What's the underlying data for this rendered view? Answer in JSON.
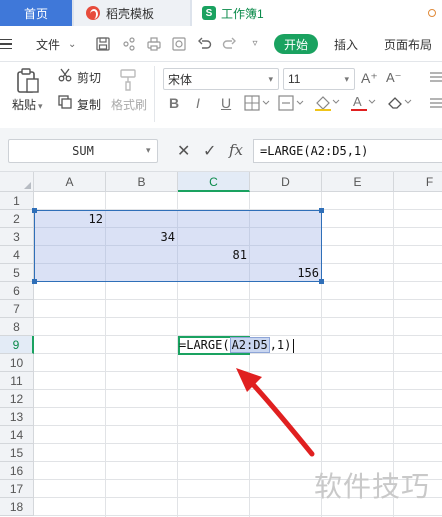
{
  "tabs": [
    {
      "label": "首页"
    },
    {
      "label": "稻壳模板"
    },
    {
      "label": "工作簿1"
    }
  ],
  "menu": {
    "file": "文件",
    "start": "开始",
    "insert": "插入",
    "page_layout": "页面布局"
  },
  "ribbon": {
    "paste": "粘贴",
    "cut": "剪切",
    "copy": "复制",
    "format_painter": "格式刷",
    "font_name": "宋体",
    "font_size": "11",
    "bold": "B",
    "italic": "I",
    "underline": "U",
    "font_grow": "A⁺",
    "font_shrink": "A⁻"
  },
  "formula_bar": {
    "name_box": "SUM",
    "formula": "=LARGE(A2:D5,1)",
    "cancel": "✕",
    "confirm": "✓",
    "fx": "fx"
  },
  "sheet": {
    "columns": [
      "A",
      "B",
      "C",
      "D",
      "E",
      "F"
    ],
    "rows": [
      "1",
      "2",
      "3",
      "4",
      "5",
      "6",
      "7",
      "8",
      "9",
      "10",
      "11",
      "12",
      "13",
      "14",
      "15",
      "16",
      "17",
      "18"
    ],
    "cells": [
      {
        "ref": "A2",
        "value": "12"
      },
      {
        "ref": "B3",
        "value": "34"
      },
      {
        "ref": "C4",
        "value": "81"
      },
      {
        "ref": "D5",
        "value": "156"
      }
    ],
    "active_cell": "C9",
    "edit_prefix": "=LARGE(",
    "edit_ref": "A2:D5",
    "edit_suffix": ",1)"
  },
  "watermark": "软件技巧",
  "colors": {
    "accent_green": "#1aa260",
    "tab_blue": "#3f78d9",
    "selection_blue": "#2f6fb8",
    "arrow_red": "#e02020"
  }
}
